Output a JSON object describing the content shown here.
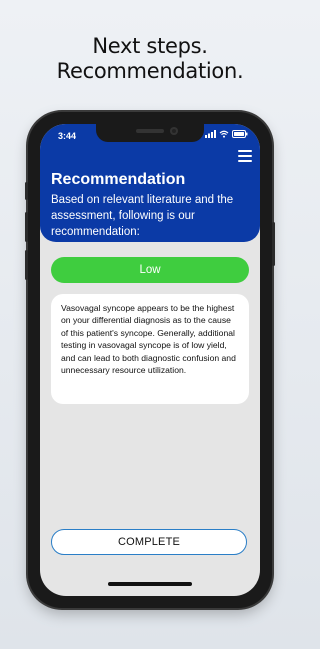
{
  "promo": {
    "line1": "Next steps.",
    "line2": "Recommendation."
  },
  "status_bar": {
    "time": "3:44",
    "icons": [
      "signal-icon",
      "wifi-icon",
      "battery-icon"
    ]
  },
  "header": {
    "title": "Recommendation",
    "subtitle": "Based on relevant literature and the assessment, following is our recommendation:",
    "menu_icon": "hamburger-menu-icon"
  },
  "risk": {
    "label": "Low",
    "color": "#3fcd3f"
  },
  "recommendation": {
    "text": "Vasovagal syncope appears to be the highest on your differential diagnosis as to the cause of this patient's syncope. Generally, additional testing in vasovagal syncope is of low yield, and can lead to both diagnostic confusion and unnecessary resource utilization."
  },
  "actions": {
    "complete_label": "COMPLETE"
  },
  "colors": {
    "header_bg": "#0b3aa6",
    "button_border": "#2a7ec7",
    "screen_bg": "#e5e5e5"
  }
}
